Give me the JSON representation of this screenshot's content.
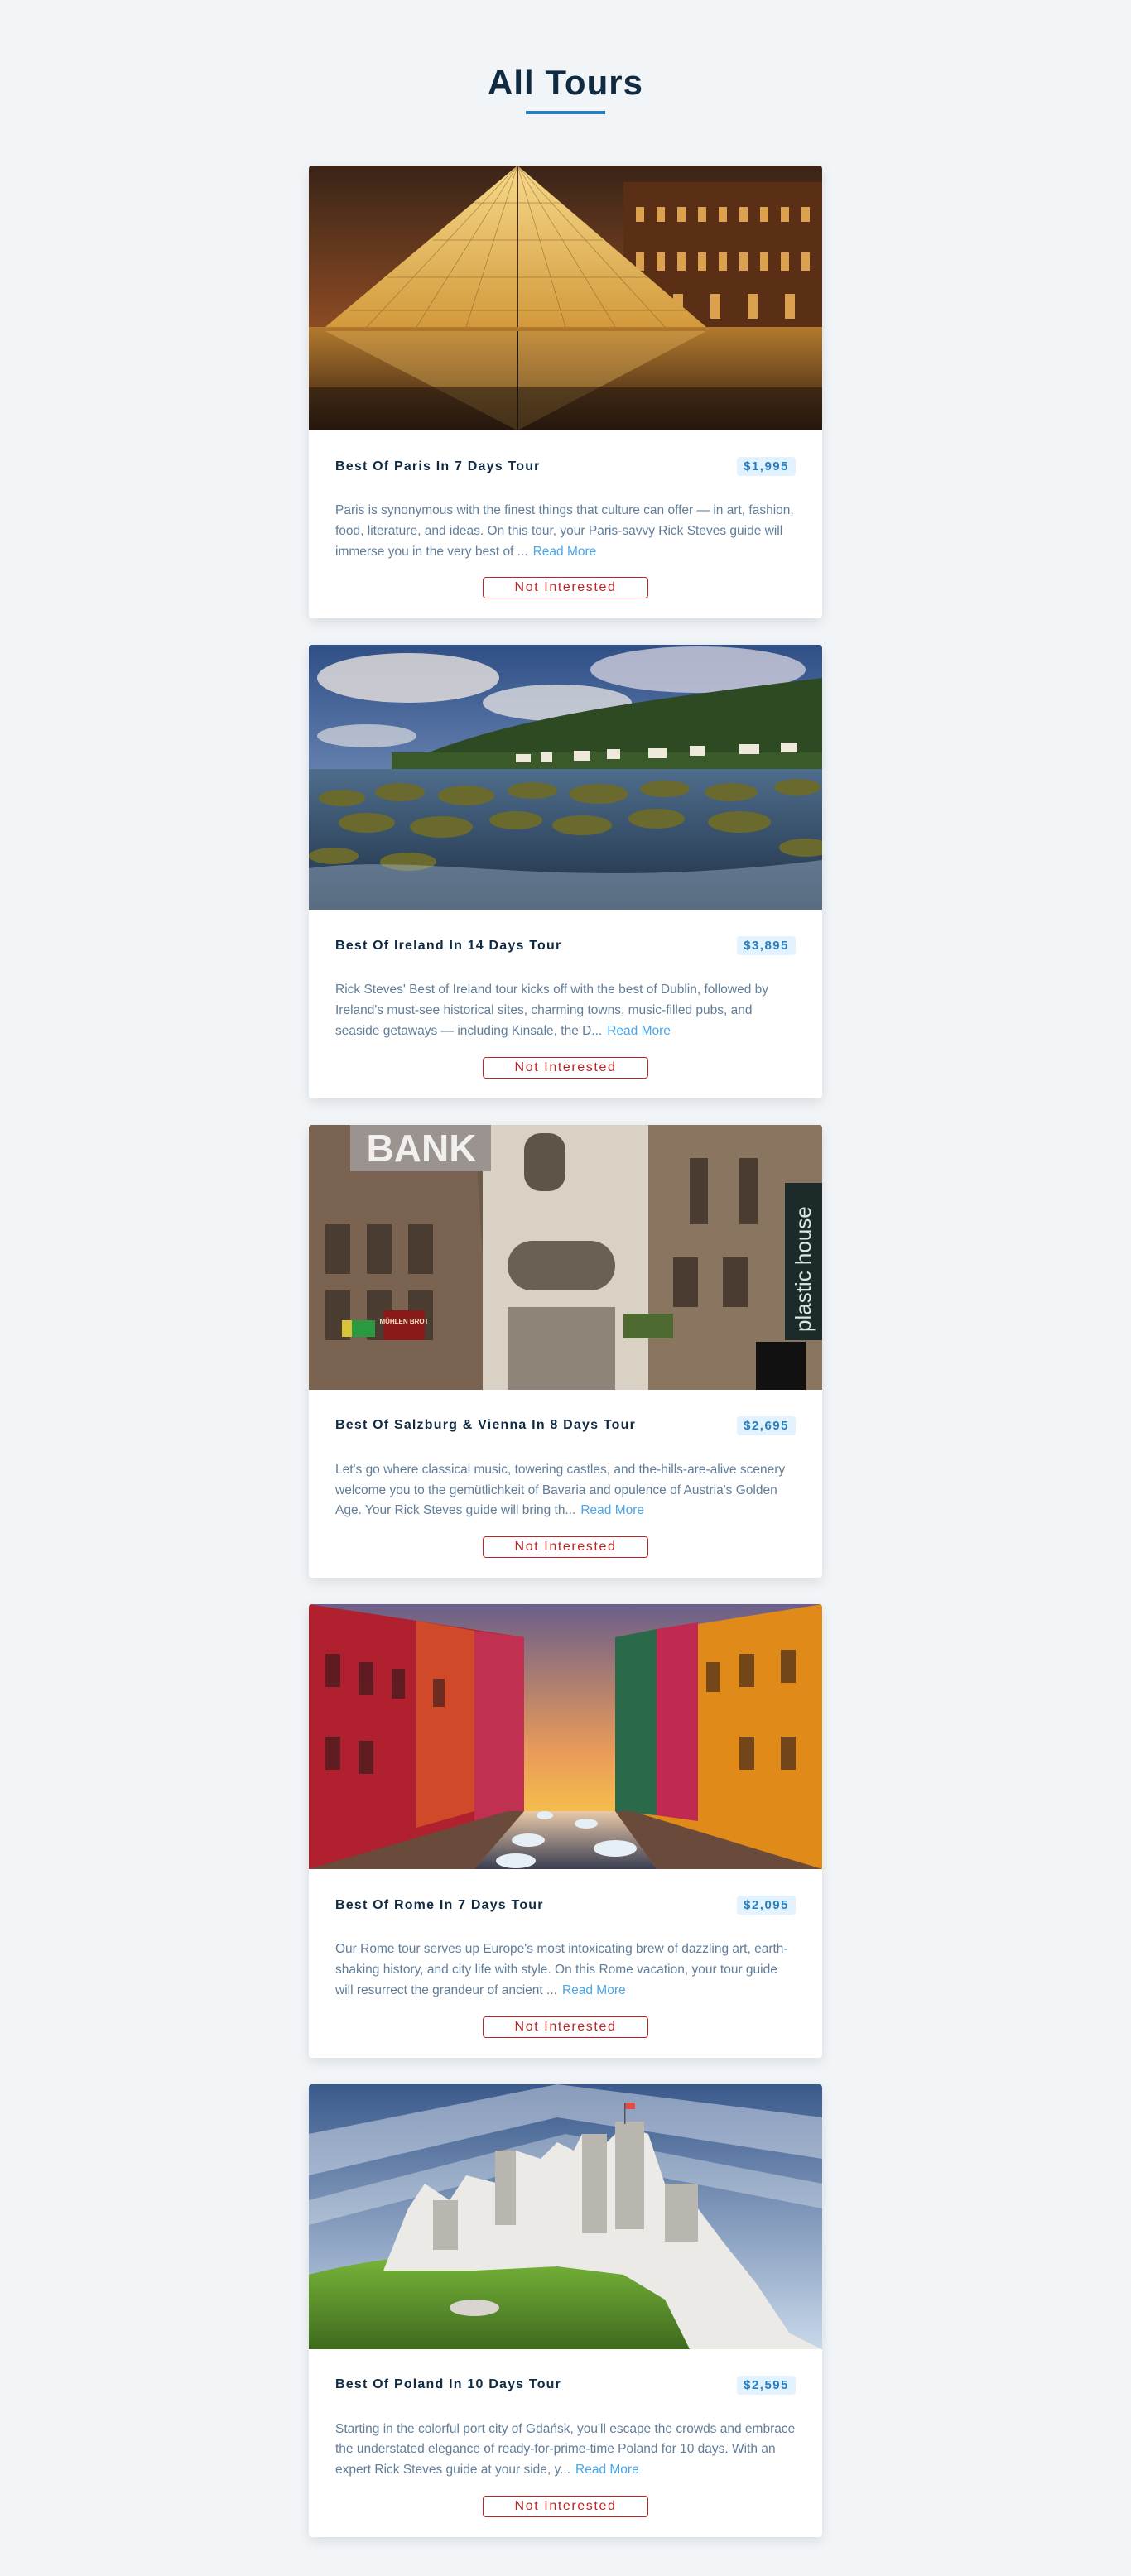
{
  "header": {
    "title": "All Tours"
  },
  "tours": [
    {
      "name": "Best Of Paris In 7 Days Tour",
      "price": "$1,995",
      "description": "Paris is synonymous with the finest things that culture can offer — in art, fashion, food, literature, and ideas. On this tour, your Paris-savvy Rick Steves guide will immerse you in the very best of ...",
      "read_more": "Read More",
      "button": "Not Interested",
      "image": "louvre-pyramid-night"
    },
    {
      "name": "Best Of Ireland In 14 Days Tour",
      "price": "$3,895",
      "description": "Rick Steves' Best of Ireland tour kicks off with the best of Dublin, followed by Ireland's must-see historical sites, charming towns, music-filled pubs, and seaside getaways — including Kinsale, the D...",
      "read_more": "Read More",
      "button": "Not Interested",
      "image": "irish-coast-village"
    },
    {
      "name": "Best Of Salzburg & Vienna In 8 Days Tour",
      "price": "$2,695",
      "description": "Let's go where classical music, towering castles, and the-hills-are-alive scenery welcome you to the gemütlichkeit of Bavaria and opulence of Austria's Golden Age. Your Rick Steves guide will bring th...",
      "read_more": "Read More",
      "button": "Not Interested",
      "image": "vienna-street",
      "image_signs": {
        "bank": "BANK",
        "right_sign": "plastic house",
        "left_sign": "MÜHLEN BROT"
      }
    },
    {
      "name": "Best Of Rome In 7 Days Tour",
      "price": "$2,095",
      "description": "Our Rome tour serves up Europe's most intoxicating brew of dazzling art, earth-shaking history, and city life with style. On this Rome vacation, your tour guide will resurrect the grandeur of ancient ...",
      "read_more": "Read More",
      "button": "Not Interested",
      "image": "canal-sunset-colorful-houses"
    },
    {
      "name": "Best Of Poland In 10 Days Tour",
      "price": "$2,595",
      "description": "Starting in the colorful port city of Gdańsk, you'll escape the crowds and embrace the understated elegance of ready-for-prime-time Poland for 10 days. With an expert Rick Steves guide at your side, y...",
      "read_more": "Read More",
      "button": "Not Interested",
      "image": "castle-ruins-hill"
    }
  ]
}
